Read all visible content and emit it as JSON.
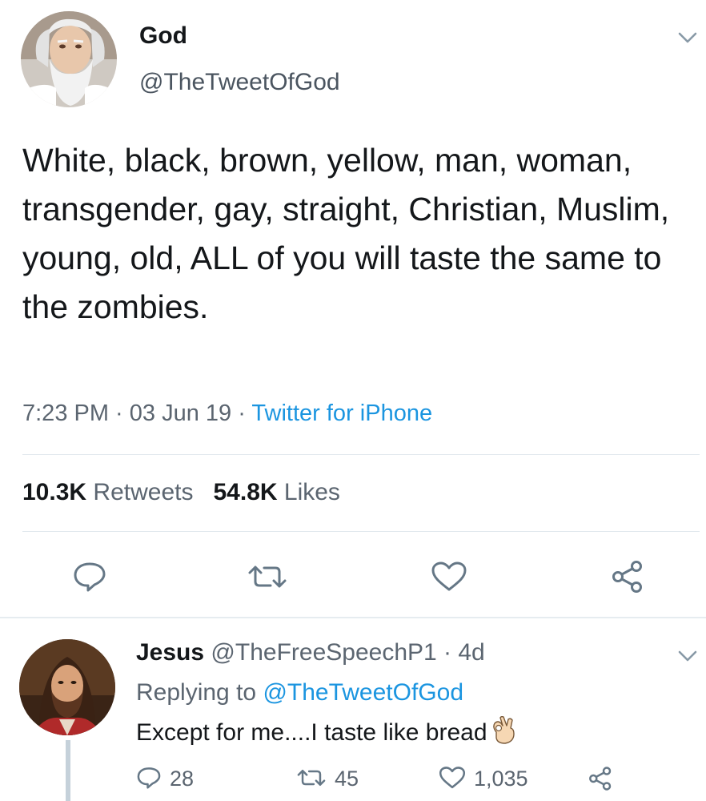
{
  "tweet": {
    "display_name": "God",
    "handle": "@TheTweetOfGod",
    "text": "White, black, brown, yellow, man, woman, transgender, gay, straight, Christian, Muslim, young, old, ALL of you will taste the same to the zombies.",
    "time": "7:23 PM",
    "sep1": " · ",
    "date": "03 Jun 19",
    "sep2": " · ",
    "source": "Twitter for iPhone",
    "retweets_count": "10.3K",
    "retweets_label": "Retweets",
    "likes_count": "54.8K",
    "likes_label": "Likes"
  },
  "reply": {
    "display_name": "Jesus",
    "handle": "@TheFreeSpeechP1",
    "sep": " · ",
    "age": "4d",
    "replying_prefix": "Replying to",
    "replying_to": "@TheTweetOfGod",
    "text": "Except for me....I taste like bread",
    "reply_count": "28",
    "retweet_count": "45",
    "like_count": "1,035"
  },
  "icons": {
    "reply": "reply-icon",
    "retweet": "retweet-icon",
    "like": "heart-icon",
    "share": "share-icon",
    "more": "chevron-down-icon",
    "emoji": "ok-hand-emoji"
  },
  "colors": {
    "link": "#1b95e0",
    "secondary_text": "#5b6570",
    "divider": "#e1e8ed"
  }
}
